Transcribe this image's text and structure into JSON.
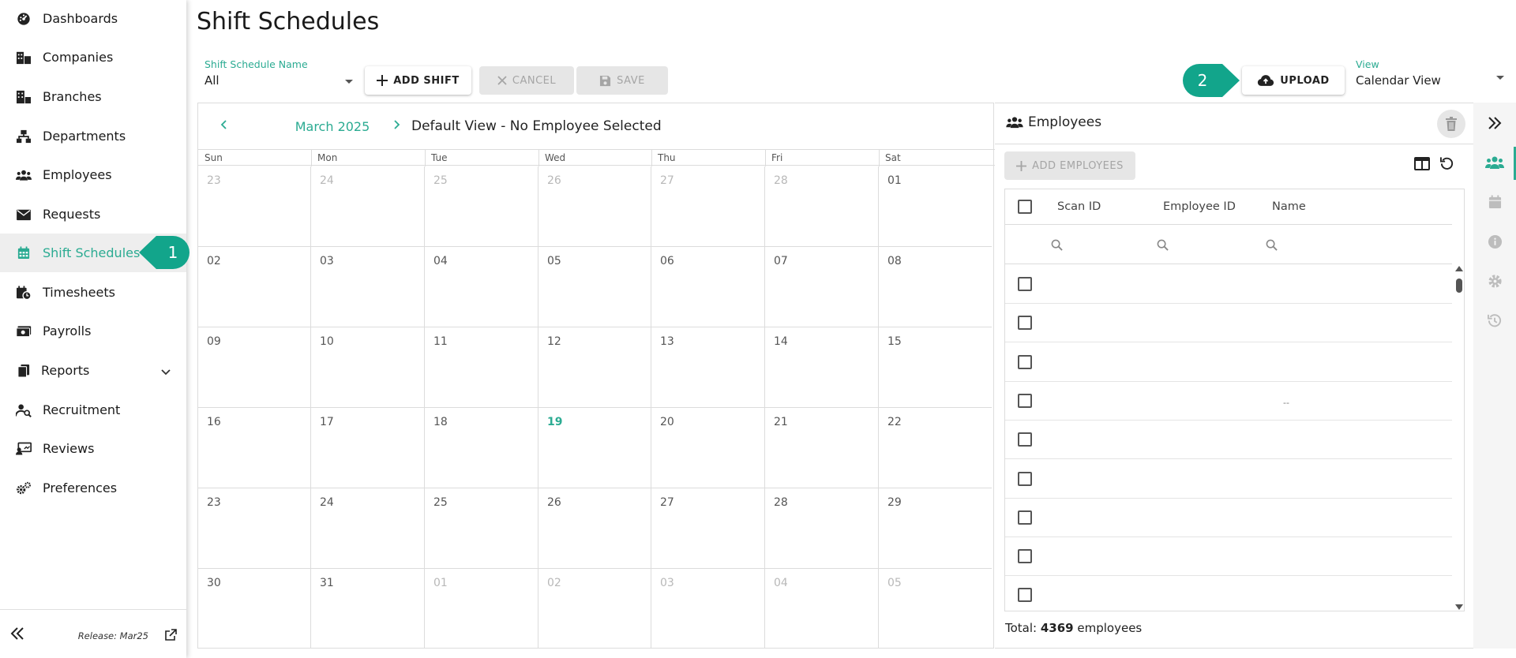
{
  "sidebar": {
    "items": [
      {
        "label": "Dashboards",
        "icon": "dashboard-icon"
      },
      {
        "label": "Companies",
        "icon": "companies-icon"
      },
      {
        "label": "Branches",
        "icon": "branches-icon"
      },
      {
        "label": "Departments",
        "icon": "departments-icon"
      },
      {
        "label": "Employees",
        "icon": "employees-icon"
      },
      {
        "label": "Requests",
        "icon": "requests-icon"
      },
      {
        "label": "Shift Schedules",
        "icon": "calendar-icon",
        "active": true
      },
      {
        "label": "Timesheets",
        "icon": "timesheets-icon"
      },
      {
        "label": "Payrolls",
        "icon": "payrolls-icon"
      },
      {
        "label": "Reports",
        "icon": "reports-icon",
        "has_children": true
      },
      {
        "label": "Recruitment",
        "icon": "recruitment-icon"
      },
      {
        "label": "Reviews",
        "icon": "reviews-icon"
      },
      {
        "label": "Preferences",
        "icon": "preferences-icon"
      }
    ],
    "release": "Release: Mar25"
  },
  "badges": {
    "one": "1",
    "two": "2"
  },
  "header": {
    "title": "Shift Schedules",
    "schedule_name_label": "Shift Schedule Name",
    "schedule_name_value": "All",
    "add_shift": "ADD SHIFT",
    "cancel": "CANCEL",
    "save": "SAVE",
    "upload": "UPLOAD",
    "view_label": "View",
    "view_value": "Calendar View"
  },
  "calendar": {
    "month": "March 2025",
    "view_text": "Default View - No Employee Selected",
    "weekdays": [
      "Sun",
      "Mon",
      "Tue",
      "Wed",
      "Thu",
      "Fri",
      "Sat"
    ],
    "weeks": [
      [
        "23",
        "24",
        "25",
        "26",
        "27",
        "28",
        "01"
      ],
      [
        "02",
        "03",
        "04",
        "05",
        "06",
        "07",
        "08"
      ],
      [
        "09",
        "10",
        "11",
        "12",
        "13",
        "14",
        "15"
      ],
      [
        "16",
        "17",
        "18",
        "19",
        "20",
        "21",
        "22"
      ],
      [
        "23",
        "24",
        "25",
        "26",
        "27",
        "28",
        "29"
      ],
      [
        "30",
        "31",
        "01",
        "02",
        "03",
        "04",
        "05"
      ]
    ],
    "today": "19"
  },
  "employees": {
    "title": "Employees",
    "add_button": "ADD EMPLOYEES",
    "columns": [
      "Scan ID",
      "Employee ID",
      "Name"
    ],
    "row_dash": "--",
    "total_prefix": "Total: ",
    "total_count": "4369",
    "total_suffix": " employees"
  },
  "colors": {
    "accent": "#2bab92",
    "badge": "#12a58b"
  }
}
